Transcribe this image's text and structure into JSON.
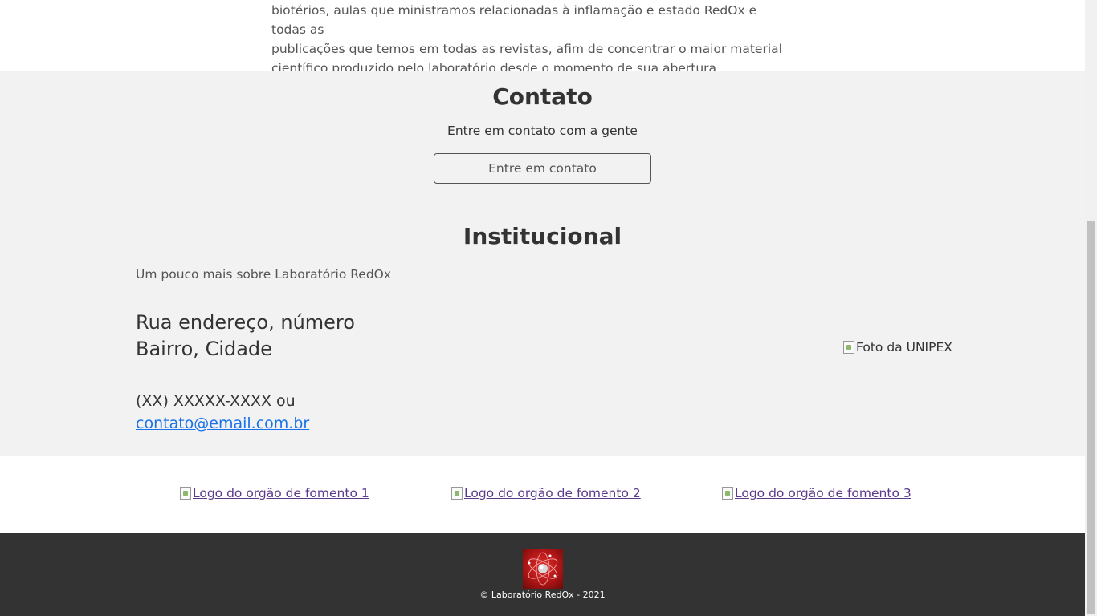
{
  "about": {
    "line1": "biotérios, aulas que ministramos relacionadas à inflamação e estado RedOx e todas as",
    "line2": "publicações que temos em todas as revistas, afim de concentrar o maior material",
    "line3": "científico produzido pelo laboratório desde o momento de sua abertura."
  },
  "contact": {
    "title": "Contato",
    "subtitle": "Entre em contato com a gente",
    "button_label": "Entre em contato"
  },
  "institutional": {
    "title": "Institucional",
    "subtitle": "Um pouco mais sobre Laboratório RedOx",
    "address_line1": "Rua endereço, número",
    "address_line2": "Bairro, Cidade",
    "phone": "(XX) XXXXX-XXXX ou",
    "email": "contato@email.com.br",
    "photo_alt": "Foto da UNIPEX"
  },
  "sponsors": [
    {
      "alt": "Logo do orgão de fomento 1"
    },
    {
      "alt": "Logo do orgão de fomento 2"
    },
    {
      "alt": "Logo do orgão de fomento 3"
    }
  ],
  "footer": {
    "copyright": "© Laboratório RedOx - 2021"
  }
}
